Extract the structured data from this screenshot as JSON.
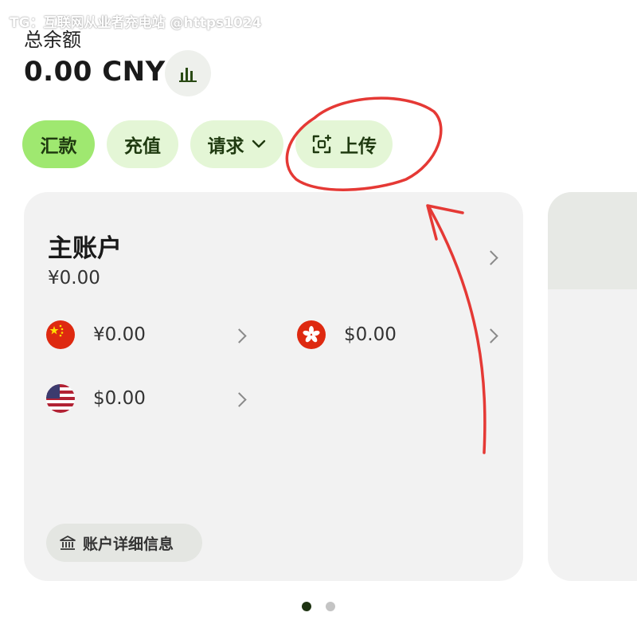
{
  "watermark": "TG：互联网从业者充电站 @https1024",
  "balance": {
    "label": "总余额",
    "amount": "0.00 CNY"
  },
  "actions": {
    "send": "汇款",
    "add_money": "充值",
    "request": "请求",
    "upload": "上传"
  },
  "account": {
    "title": "主账户",
    "balance": "¥0.00",
    "currencies": [
      {
        "flag": "china-flag-icon",
        "amount": "¥0.00"
      },
      {
        "flag": "hong-kong-flag-icon",
        "amount": "$0.00"
      },
      {
        "flag": "usa-flag-icon",
        "amount": "$0.00"
      }
    ],
    "details_label": "账户详细信息"
  },
  "colors": {
    "primary_green": "#9fe870",
    "light_green": "#e4f6d6",
    "annotation_red": "#e53935"
  },
  "pagination": {
    "total": 2,
    "active": 1
  }
}
